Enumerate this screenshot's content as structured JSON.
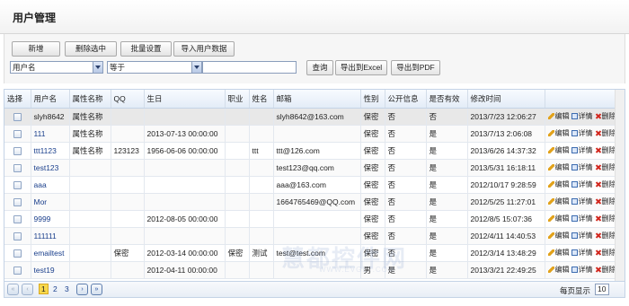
{
  "page": {
    "title": "用户管理"
  },
  "toolbar": {
    "add": "新增",
    "delete_selected": "删除选中",
    "batch_settings": "批量设置",
    "import_users": "导入用户数据",
    "field_select": "用户名",
    "operator_select": "等于",
    "search_value": "",
    "query": "查询",
    "export_excel": "导出到Excel",
    "export_pdf": "导出到PDF"
  },
  "table": {
    "headers": [
      "选择",
      "用户名",
      "属性名称",
      "QQ",
      "生日",
      "职业",
      "姓名",
      "邮箱",
      "性别",
      "公开信息",
      "是否有效",
      "修改时间",
      ""
    ],
    "rows": [
      [
        "",
        "slyh8642",
        "属性名称",
        "",
        "",
        "",
        "",
        "slyh8642@163.com",
        "保密",
        "否",
        "否",
        "2013/7/23 12:06:27"
      ],
      [
        "",
        "111",
        "属性名称",
        "",
        "2013-07-13 00:00:00",
        "",
        "",
        "",
        "保密",
        "否",
        "是",
        "2013/7/13 2:06:08"
      ],
      [
        "",
        "ttt1123",
        "属性名称",
        "123123",
        "1956-06-06 00:00:00",
        "",
        "ttt",
        "ttt@126.com",
        "保密",
        "否",
        "是",
        "2013/6/26 14:37:32"
      ],
      [
        "",
        "test123",
        "",
        "",
        "",
        "",
        "",
        "test123@qq.com",
        "保密",
        "否",
        "是",
        "2013/5/31 16:18:11"
      ],
      [
        "",
        "aaa",
        "",
        "",
        "",
        "",
        "",
        "aaa@163.com",
        "保密",
        "否",
        "是",
        "2012/10/17 9:28:59"
      ],
      [
        "",
        "Mor",
        "",
        "",
        "",
        "",
        "",
        "1664765469@QQ.com",
        "保密",
        "否",
        "是",
        "2012/5/25 11:27:01"
      ],
      [
        "",
        "9999",
        "",
        "",
        "2012-08-05 00:00:00",
        "",
        "",
        "",
        "保密",
        "否",
        "是",
        "2012/8/5 15:07:36"
      ],
      [
        "",
        "111111",
        "",
        "",
        "",
        "",
        "",
        "",
        "保密",
        "否",
        "是",
        "2012/4/11 14:40:53"
      ],
      [
        "",
        "emailtest",
        "",
        "保密",
        "2012-03-14 00:00:00",
        "保密",
        "测试",
        "test@test.com",
        "保密",
        "否",
        "是",
        "2012/3/14 13:48:29"
      ],
      [
        "",
        "test19",
        "",
        "",
        "2012-04-11 00:00:00",
        "",
        "",
        "",
        "男",
        "是",
        "是",
        "2013/3/21 22:49:25"
      ]
    ],
    "actions": {
      "edit": "编辑",
      "detail": "详情",
      "delete": "删除"
    }
  },
  "watermark": {
    "main": "慧都控件网",
    "sub": "WWW.EVGET.COM"
  },
  "pager": {
    "pages": [
      "1",
      "2",
      "3"
    ],
    "current": "1",
    "page_size_label": "每页显示",
    "page_size": "10"
  }
}
